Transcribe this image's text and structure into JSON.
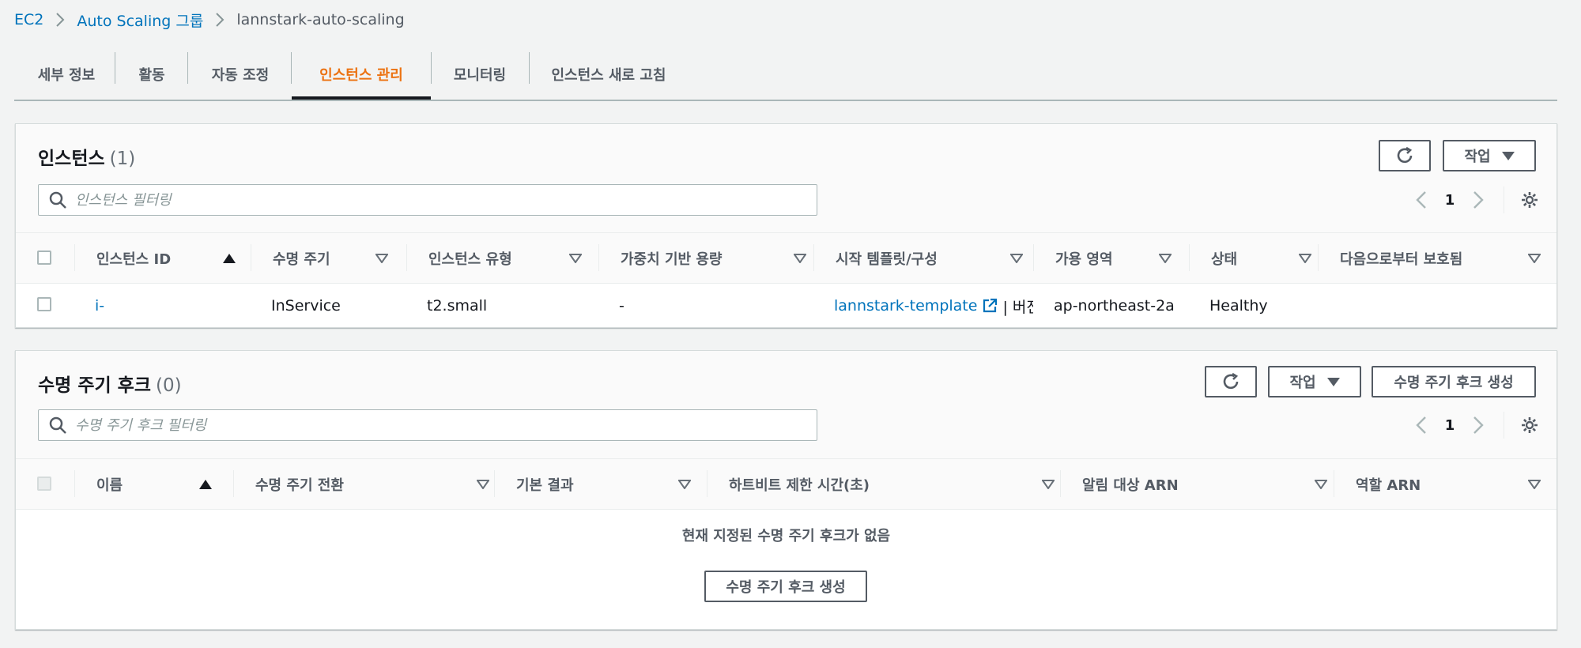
{
  "breadcrumb": {
    "items": [
      "EC2",
      "Auto Scaling 그룹",
      "lannstark-auto-scaling"
    ]
  },
  "tabs": [
    "세부 정보",
    "활동",
    "자동 조정",
    "인스턴스 관리",
    "모니터링",
    "인스턴스 새로 고침"
  ],
  "active_tab": "인스턴스 관리",
  "instances_panel": {
    "title": "인스턴스",
    "count": "(1)",
    "actions_label": "작업",
    "filter_placeholder": "인스턴스 필터링",
    "page": "1",
    "columns": [
      "인스턴스 ID",
      "수명 주기",
      "인스턴스 유형",
      "가중치 기반 용량",
      "시작 템플릿/구성",
      "가용 영역",
      "상태",
      "다음으로부터 보호됨"
    ],
    "rows": [
      {
        "instance_id": "i-",
        "lifecycle": "InService",
        "instance_type": "t2.small",
        "weighted_capacity": "-",
        "template": "lannstark-template",
        "template_suffix": "| 버전 ′",
        "az": "ap-northeast-2a",
        "health": "Healthy",
        "protected": ""
      }
    ]
  },
  "hooks_panel": {
    "title": "수명 주기 후크",
    "count": "(0)",
    "actions_label": "작업",
    "create_label": "수명 주기 후크 생성",
    "filter_placeholder": "수명 주기 후크 필터링",
    "page": "1",
    "columns": [
      "이름",
      "수명 주기 전환",
      "기본 결과",
      "하트비트 제한 시간(초)",
      "알림 대상 ARN",
      "역할 ARN"
    ],
    "empty_text": "현재 지정된 수명 주기 후크가 없음",
    "empty_button_label": "수명 주기 후크 생성"
  },
  "colors": {
    "accent": "#ec7211",
    "link": "#0073bb",
    "text": "#16191f",
    "muted": "#545b64"
  }
}
